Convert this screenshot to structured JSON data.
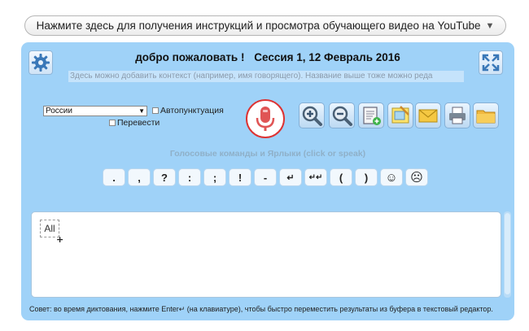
{
  "banner": {
    "text": "Нажмите здесь для получения инструкций и просмотра обучающего видео на YouTube",
    "arrow": "▼"
  },
  "header": {
    "welcome": "добро пожаловать !",
    "session": "Сессия 1, 12 Февраль 2016",
    "context_placeholder": "Здесь можно добавить контекст (например, имя говорящего). Название выше тоже можно реда"
  },
  "controls": {
    "language": "России",
    "autopunct_label": "Автопунктуация",
    "translate_label": "Перевести"
  },
  "voice_commands": {
    "label": "Голосовые команды и Ярлыки (click or speak)",
    "buttons": [
      ".",
      ",",
      "?",
      ":",
      ";",
      "!",
      "-",
      "↵",
      "↵↵",
      "(",
      ")",
      "☺",
      "☹"
    ]
  },
  "editor": {
    "all_label": "All",
    "plus": "+"
  },
  "tip": "Совет: во время диктования, нажмите Enter↵ (на клавиатуре), чтобы быстро переместить результаты из буфера в текстовый редактор.",
  "colors": {
    "panel": "#9fd2f8",
    "mic_ring": "#d33333"
  },
  "icons": [
    "settings-icon",
    "fullscreen-icon",
    "microphone-icon",
    "zoom-in-icon",
    "zoom-out-icon",
    "new-note-icon",
    "notes-icon",
    "email-icon",
    "print-icon",
    "folder-icon"
  ]
}
